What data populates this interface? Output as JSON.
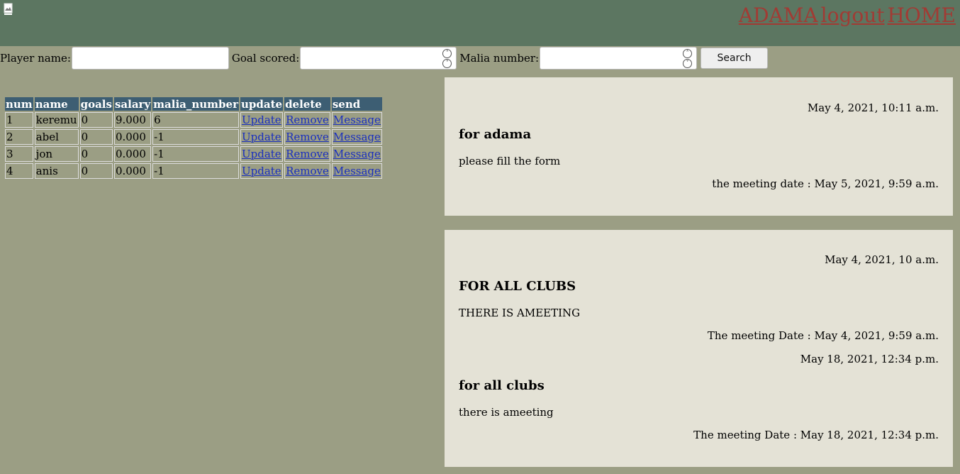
{
  "header": {
    "nav": [
      "ADAMA",
      "logout",
      "HOME"
    ]
  },
  "search": {
    "player_name_label": "Player name:",
    "player_name_value": "",
    "goal_label": "Goal scored:",
    "goal_value": "",
    "malia_label": "Malia number:",
    "malia_value": "",
    "button": "Search"
  },
  "table": {
    "columns": [
      "num",
      "name",
      "goals",
      "salary",
      "malia_number",
      "update",
      "delete",
      "send"
    ],
    "rows": [
      {
        "num": "1",
        "name": "keremu",
        "goals": "0",
        "salary": "9.000",
        "malia": "6",
        "update": "Update",
        "delete": "Remove",
        "send": "Message"
      },
      {
        "num": "2",
        "name": "abel",
        "goals": "0",
        "salary": "0.000",
        "malia": "-1",
        "update": "Update",
        "delete": "Remove",
        "send": "Message"
      },
      {
        "num": "3",
        "name": "jon",
        "goals": "0",
        "salary": "0.000",
        "malia": "-1",
        "update": "Update",
        "delete": "Remove",
        "send": "Message"
      },
      {
        "num": "4",
        "name": "anis",
        "goals": "0",
        "salary": "0.000",
        "malia": "-1",
        "update": "Update",
        "delete": "Remove",
        "send": "Message"
      }
    ]
  },
  "messages": [
    {
      "date": "May 4, 2021, 10:11 a.m.",
      "title": "for adama",
      "body": "please fill the form",
      "meeting": "the meeting date : May 5, 2021, 9:59 a.m."
    },
    {
      "date": "May 4, 2021, 10 a.m.",
      "title": "FOR ALL CLUBS",
      "body": "THERE IS AMEETING",
      "meeting": "The meeting Date : May 4, 2021, 9:59 a.m."
    },
    {
      "date": "May 18, 2021, 12:34 p.m.",
      "title": "for all clubs",
      "body": "there is ameeting",
      "meeting": "The meeting Date : May 18, 2021, 12:34 p.m."
    }
  ],
  "colors": {
    "header_bg": "#5c7661",
    "page_bg": "#9b9e84",
    "nav_link": "#a13b34",
    "table_header_bg": "#3d5e73",
    "card_bg": "#e4e2d6"
  }
}
